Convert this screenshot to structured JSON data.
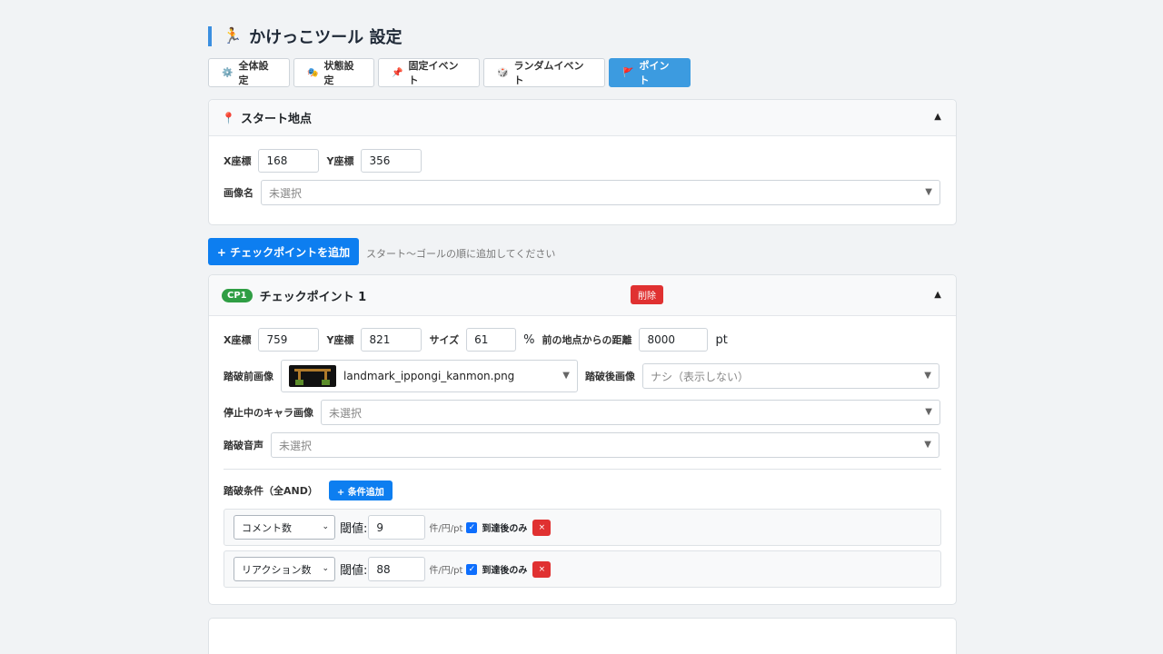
{
  "header": {
    "title_icon": "🏃",
    "title": "かけっこツール 設定"
  },
  "tabs": [
    {
      "icon": "⚙️",
      "label": "全体設定"
    },
    {
      "icon": "🎭",
      "label": "状態設定"
    },
    {
      "icon": "📌",
      "label": "固定イベント"
    },
    {
      "icon": "🎲",
      "label": "ランダムイベント"
    },
    {
      "icon": "🚩",
      "label": "ポイント"
    }
  ],
  "start": {
    "icon": "📍",
    "title": "スタート地点",
    "x_label": "X座標",
    "x_value": "168",
    "y_label": "Y座標",
    "y_value": "356",
    "image_label": "画像名",
    "image_value": "未選択"
  },
  "add_checkpoint": {
    "label": "+ チェックポイントを追加",
    "hint": "スタート〜ゴールの順に追加してください"
  },
  "checkpoint": {
    "badge": "CP1",
    "title": "チェックポイント 1",
    "delete_label": "削除",
    "x_label": "X座標",
    "x_value": "759",
    "y_label": "Y座標",
    "y_value": "821",
    "size_label": "サイズ",
    "size_value": "61",
    "size_unit": "%",
    "distance_label": "前の地点からの距離",
    "distance_value": "8000",
    "distance_unit": "pt",
    "before_image_label": "踏破前画像",
    "before_image_value": "landmark_ippongi_kanmon.png",
    "after_image_label": "踏破後画像",
    "after_image_value": "ナシ（表示しない）",
    "stopped_label": "停止中のキャラ画像",
    "stopped_value": "未選択",
    "sound_label": "踏破音声",
    "sound_value": "未選択",
    "conditions_label": "踏破条件（全AND）",
    "add_condition_label": "+ 条件追加",
    "conditions": [
      {
        "type": "コメント数",
        "threshold_label": "閾値:",
        "threshold": "9",
        "unit": "件/円/pt",
        "after_only": "到達後のみ",
        "remove": "×"
      },
      {
        "type": "リアクション数",
        "threshold_label": "閾値:",
        "threshold": "88",
        "unit": "件/円/pt",
        "after_only": "到達後のみ",
        "remove": "×"
      }
    ]
  }
}
